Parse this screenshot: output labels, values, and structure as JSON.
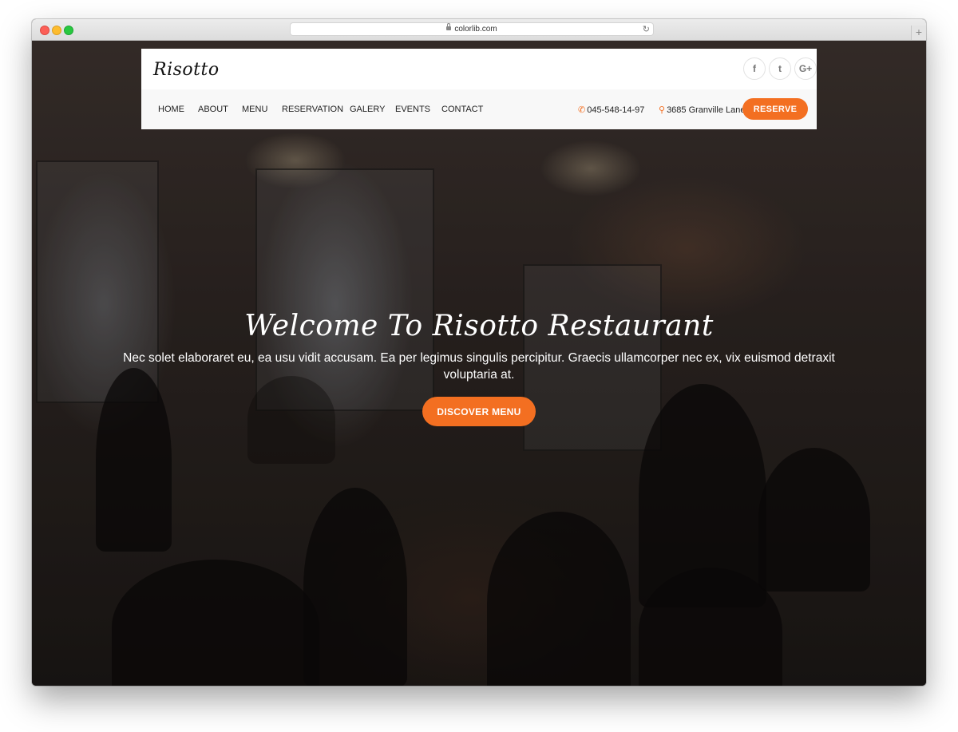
{
  "browser": {
    "url": "colorlib.com",
    "reload_icon": "↻",
    "new_tab_icon": "+"
  },
  "site": {
    "logo": "Risotto",
    "social": [
      {
        "name": "facebook",
        "glyph": "f"
      },
      {
        "name": "twitter",
        "glyph": "t"
      },
      {
        "name": "google-plus",
        "glyph": "G+"
      }
    ],
    "nav": [
      "HOME",
      "ABOUT",
      "MENU",
      "RESERVATION",
      "GALERY",
      "EVENTS",
      "CONTACT"
    ],
    "phone": "045-548-14-97",
    "address": "3685 Granville Lane",
    "reserve_label": "RESERVE",
    "accent_color": "#f36f21"
  },
  "hero": {
    "title": "Welcome To Risotto Restaurant",
    "text": "Nec solet elaboraret eu, ea usu vidit accusam. Ea per legimus singulis percipitur. Graecis ullamcorper nec ex, vix euismod detraxit voluptaria at.",
    "button_label": "DISCOVER MENU"
  }
}
